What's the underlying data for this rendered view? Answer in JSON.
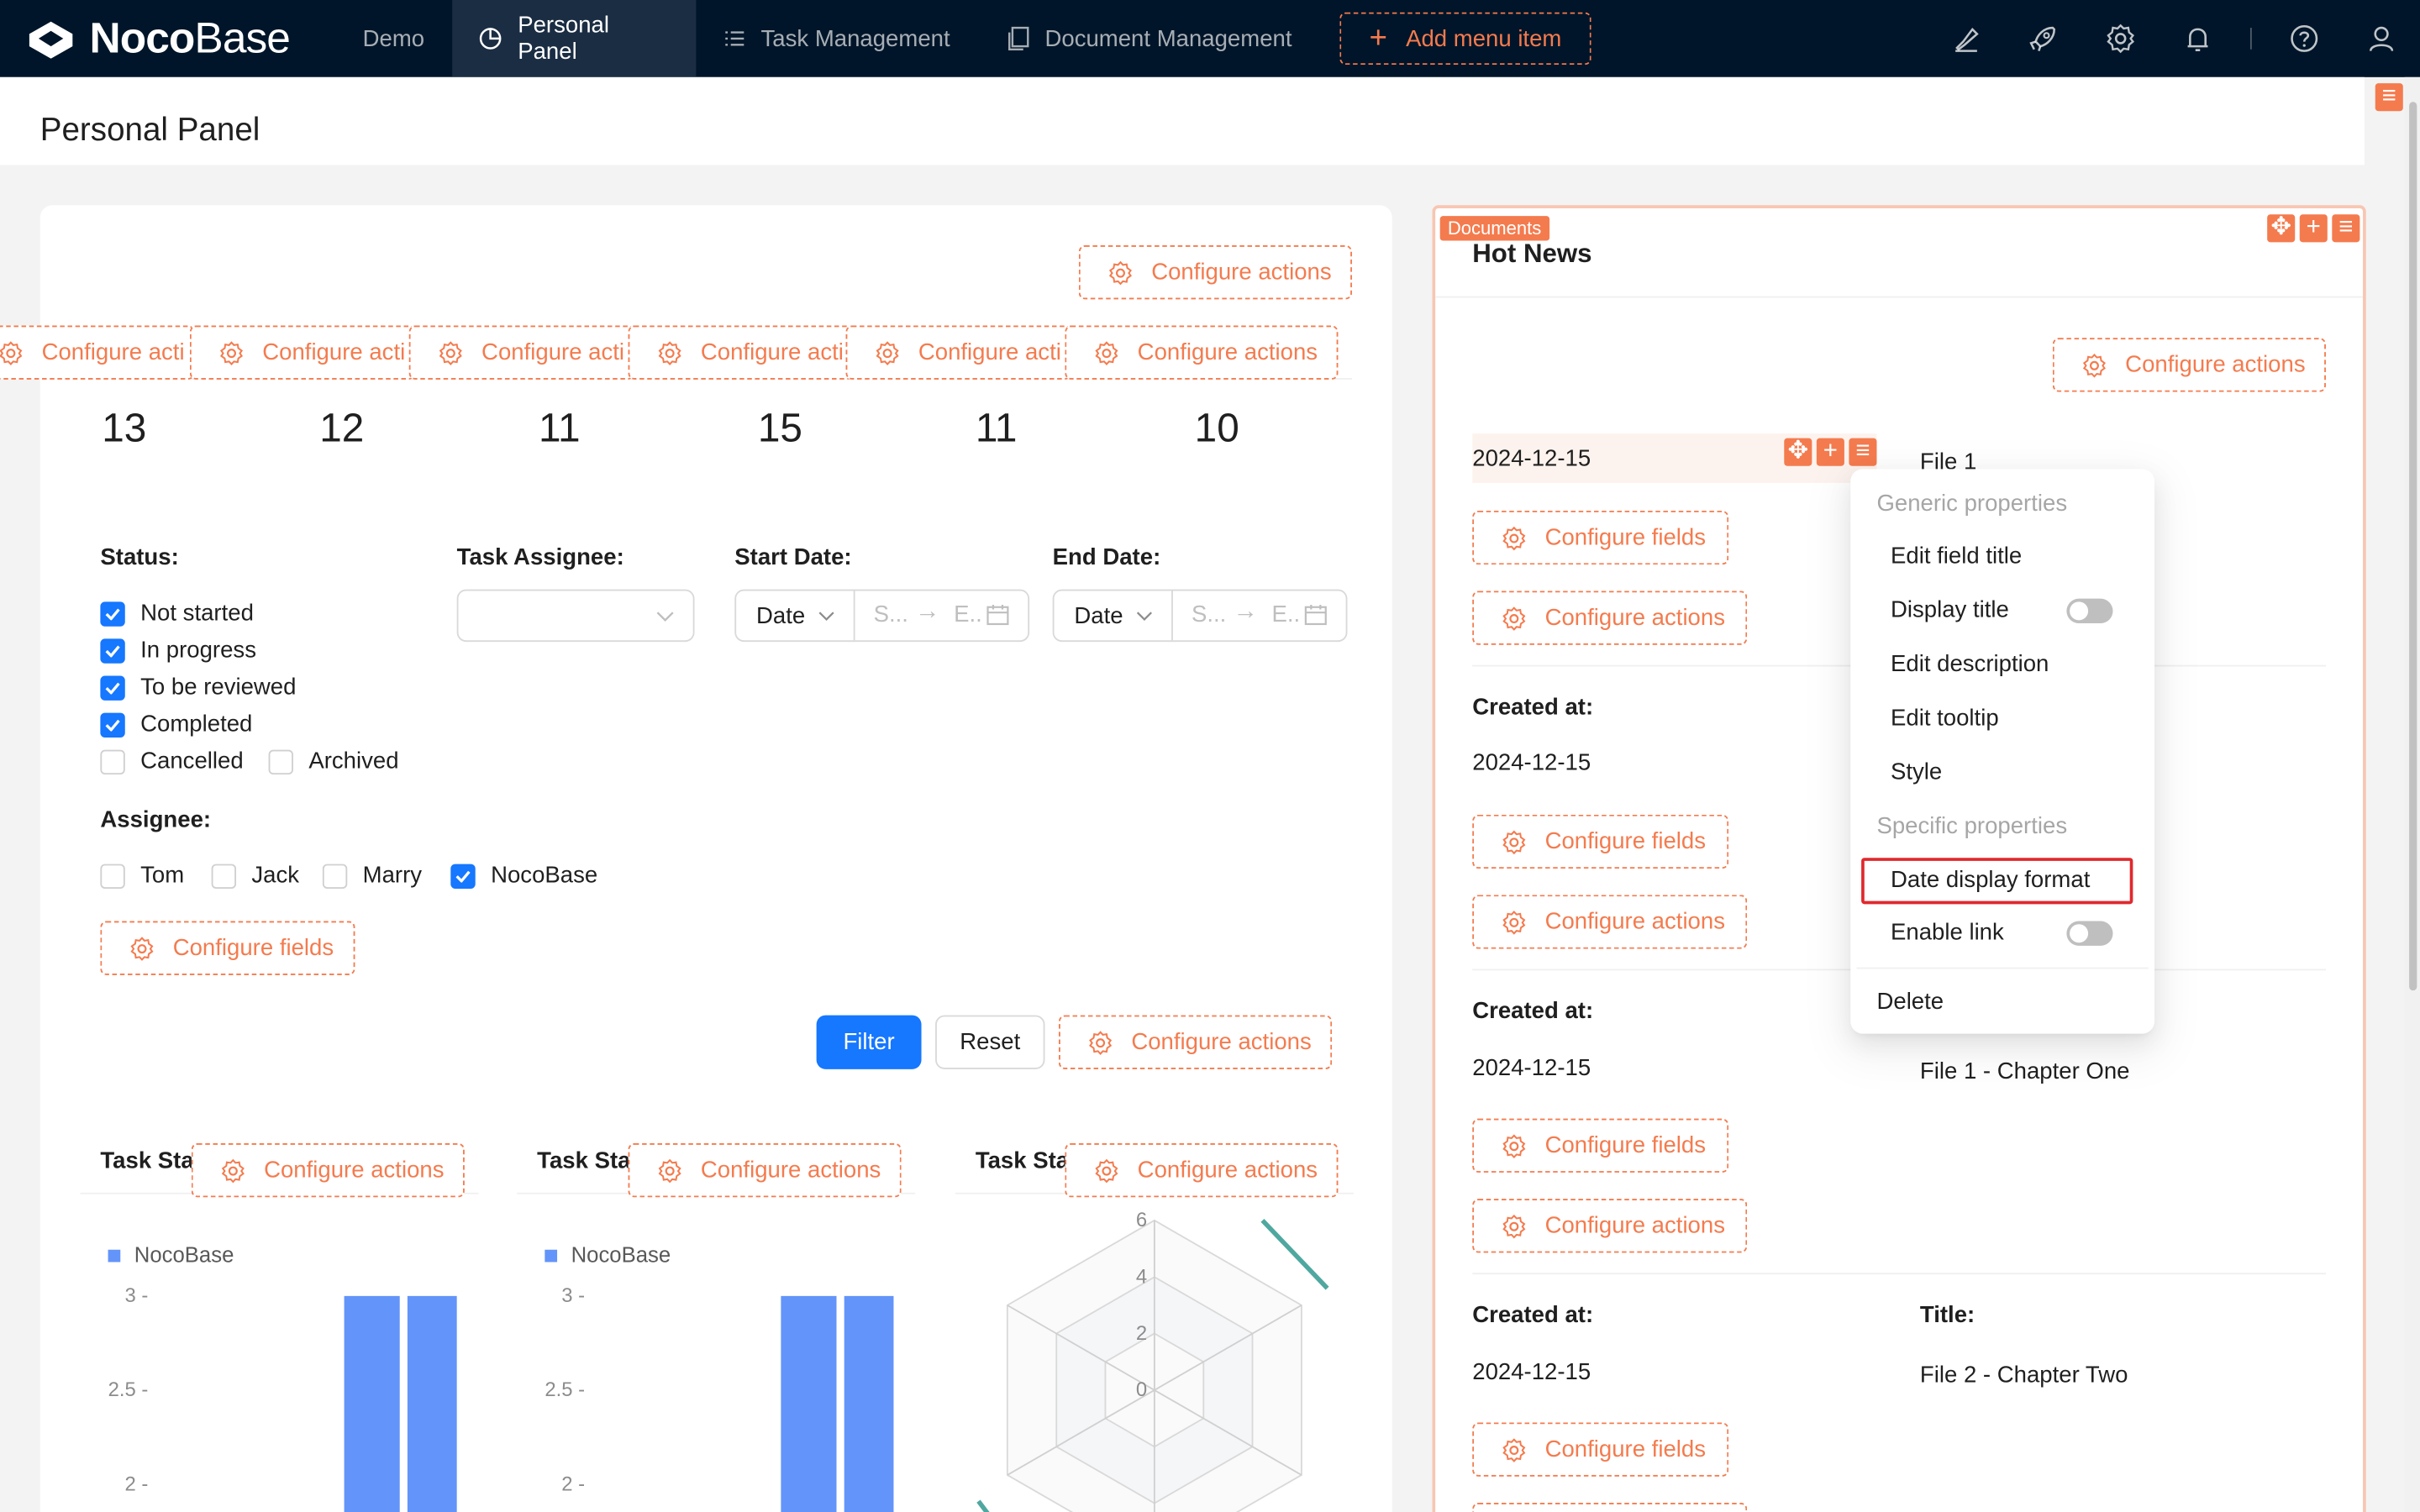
{
  "app": {
    "logo_bold": "Noco",
    "logo_light": "Base"
  },
  "topnav": {
    "items": [
      {
        "label": "Demo"
      },
      {
        "label": "Personal Panel"
      },
      {
        "label": "Task Management"
      },
      {
        "label": "Document Management"
      }
    ],
    "add_label": "Add menu item",
    "icons": [
      "highlighter-icon",
      "rocket-icon",
      "gear-icon",
      "bell-icon",
      "help-icon",
      "user-icon"
    ]
  },
  "page": {
    "title": "Personal Panel"
  },
  "left": {
    "configure_actions": "Configure actions",
    "configure_fields": "Configure fields",
    "stats_action_truncated": "Configure acti",
    "stats": [
      "13",
      "12",
      "11",
      "15",
      "11",
      "10"
    ],
    "filter": {
      "status_label": "Status",
      "status_options": [
        {
          "label": "Not started",
          "checked": true
        },
        {
          "label": "In progress",
          "checked": true
        },
        {
          "label": "To be reviewed",
          "checked": true
        },
        {
          "label": "Completed",
          "checked": true
        },
        {
          "label": "Cancelled",
          "checked": false
        },
        {
          "label": "Archived",
          "checked": false
        }
      ],
      "task_assignee_label": "Task Assignee",
      "start_date_label": "Start Date",
      "end_date_label": "End Date",
      "date_type": "Date",
      "range_start_placeholder": "S...",
      "range_end_placeholder": "E..",
      "assignee_label": "Assignee",
      "assignee_options": [
        {
          "label": "Tom",
          "checked": false
        },
        {
          "label": "Jack",
          "checked": false
        },
        {
          "label": "Marry",
          "checked": false
        },
        {
          "label": "NocoBase",
          "checked": true
        }
      ],
      "filter_button": "Filter",
      "reset_button": "Reset"
    },
    "charts_title": "Task Stat"
  },
  "chart_data": [
    {
      "type": "bar",
      "title": "",
      "series": [
        {
          "name": "NocoBase",
          "values": [
            3,
            3
          ]
        }
      ],
      "categories": [
        "",
        ""
      ],
      "yticks": [
        "3",
        "2.5",
        "2"
      ],
      "ylim_visible": [
        2,
        3
      ],
      "color": "#6394f9"
    },
    {
      "type": "bar",
      "title": "",
      "series": [
        {
          "name": "NocoBase",
          "values": [
            3,
            3
          ]
        }
      ],
      "categories": [
        "",
        ""
      ],
      "yticks": [
        "3",
        "2.5",
        "2"
      ],
      "ylim_visible": [
        2,
        3
      ],
      "color": "#6394f9"
    },
    {
      "type": "radar",
      "title": "",
      "rings": [
        "6",
        "4",
        "2",
        "0"
      ],
      "ring_values": [
        6,
        4,
        2,
        0
      ],
      "axes": 6,
      "color": "#4fa8a0"
    }
  ],
  "right": {
    "tag": "Documents",
    "title": "Hot News",
    "configure_actions": "Configure actions",
    "configure_fields": "Configure fields",
    "created_label": "Created at",
    "title_label": "Title",
    "rows": [
      {
        "date": "2024-12-15",
        "title": "File 1"
      },
      {
        "date": "2024-12-15",
        "title": ""
      },
      {
        "date": "2024-12-15",
        "title": "File 1 - Chapter One"
      },
      {
        "date": "2024-12-15",
        "title": "File 2 - Chapter Two"
      }
    ]
  },
  "context_menu": {
    "generic_header": "Generic properties",
    "edit_field_title": "Edit field title",
    "display_title": "Display title",
    "display_title_on": false,
    "edit_description": "Edit description",
    "edit_tooltip": "Edit tooltip",
    "style": "Style",
    "specific_header": "Specific properties",
    "date_display_format": "Date display format",
    "enable_link": "Enable link",
    "enable_link_on": false,
    "delete": "Delete"
  },
  "colors": {
    "accent": "#f47b4e",
    "primary": "#1677ff",
    "topbar": "#001529",
    "bar": "#6394f9"
  }
}
